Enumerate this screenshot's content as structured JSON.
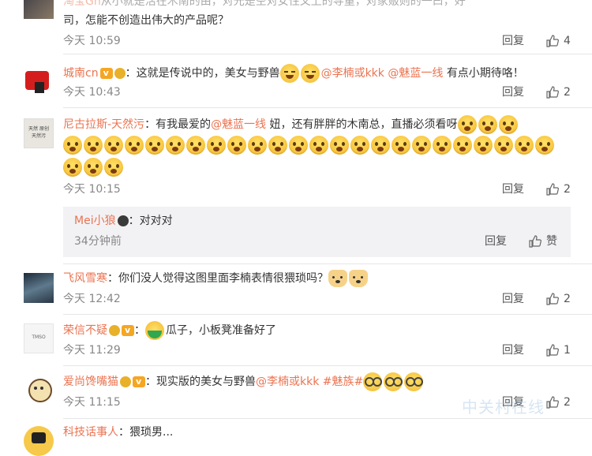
{
  "top": {
    "line1_partial": "从小就是活在木南的由，对光是空对女性又上的导重，对家贩则的一曰，好",
    "line2": "司，怎能不创造出伟大的产品呢？",
    "time": "今天 10:59",
    "reply": "回复",
    "likes": "4"
  },
  "c1": {
    "user": "城南cn",
    "text_a": "：这就是传说中的，美女与野兽",
    "mention1": "@李楠或kkk",
    "mention2": "@魅蓝一线",
    "text_b": "有点小期待咯！",
    "time": "今天 10:43",
    "reply": "回复",
    "likes": "2"
  },
  "c2": {
    "user": "尼古拉斯-天然污",
    "text_a": "：有我最爱的",
    "mention1": "@魅蓝一线",
    "text_b": "妞，还有胖胖的木南总，直播必须看呀",
    "time": "今天 10:15",
    "reply": "回复",
    "likes": "2",
    "avatar_text": "天然 原创 天然污"
  },
  "sub": {
    "user": "Mei小狼",
    "text": "：对对对",
    "time": "34分钟前",
    "reply": "回复",
    "like": "赞"
  },
  "c3": {
    "user": "飞风雪寒",
    "text": "：你们没人觉得这图里面李楠表情很猥琐吗？",
    "time": "今天 12:42",
    "reply": "回复",
    "likes": "2"
  },
  "c4": {
    "user": "荣信不疑",
    "text": "瓜子，小板凳准备好了",
    "time": "今天 11:29",
    "reply": "回复",
    "likes": "1",
    "avatar_text": "TMSO"
  },
  "c5": {
    "user": "爱尚馋嘴猫",
    "text_a": "：现实版的美女与野兽",
    "mention1": "@李楠或kkk",
    "topic": "#魅族#",
    "time": "今天 11:15",
    "reply": "回复",
    "likes": "2"
  },
  "c6": {
    "user": "科技话事人",
    "text": "：猥琐男..."
  },
  "watermark": "中关村在线"
}
